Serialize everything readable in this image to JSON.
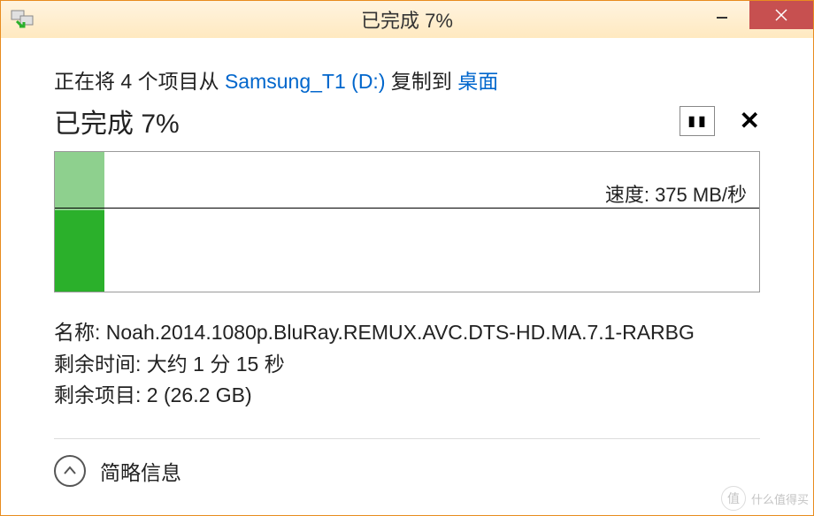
{
  "titlebar": {
    "title": "已完成 7%"
  },
  "copy": {
    "prefix": "正在将 4 个项目从 ",
    "source": "Samsung_T1 (D:)",
    "mid": " 复制到 ",
    "dest": "桌面"
  },
  "progress": {
    "label": "已完成 7%",
    "percent": 7
  },
  "chart_data": {
    "type": "area",
    "speed_label": "速度: 375 MB/秒",
    "progress_percent_width": 7,
    "speed_line_fraction": 0.4,
    "peak_fraction": 0.0,
    "current_fraction": 0.42
  },
  "details": {
    "name_label": "名称: ",
    "name_value": "Noah.2014.1080p.BluRay.REMUX.AVC.DTS-HD.MA.7.1-RARBG",
    "time_label": "剩余时间: ",
    "time_value": "大约 1 分 15 秒",
    "items_label": "剩余项目: ",
    "items_value": "2 (26.2 GB)"
  },
  "toggle": {
    "label": "简略信息"
  },
  "watermark": {
    "icon": "值",
    "text": "什么值得买"
  }
}
